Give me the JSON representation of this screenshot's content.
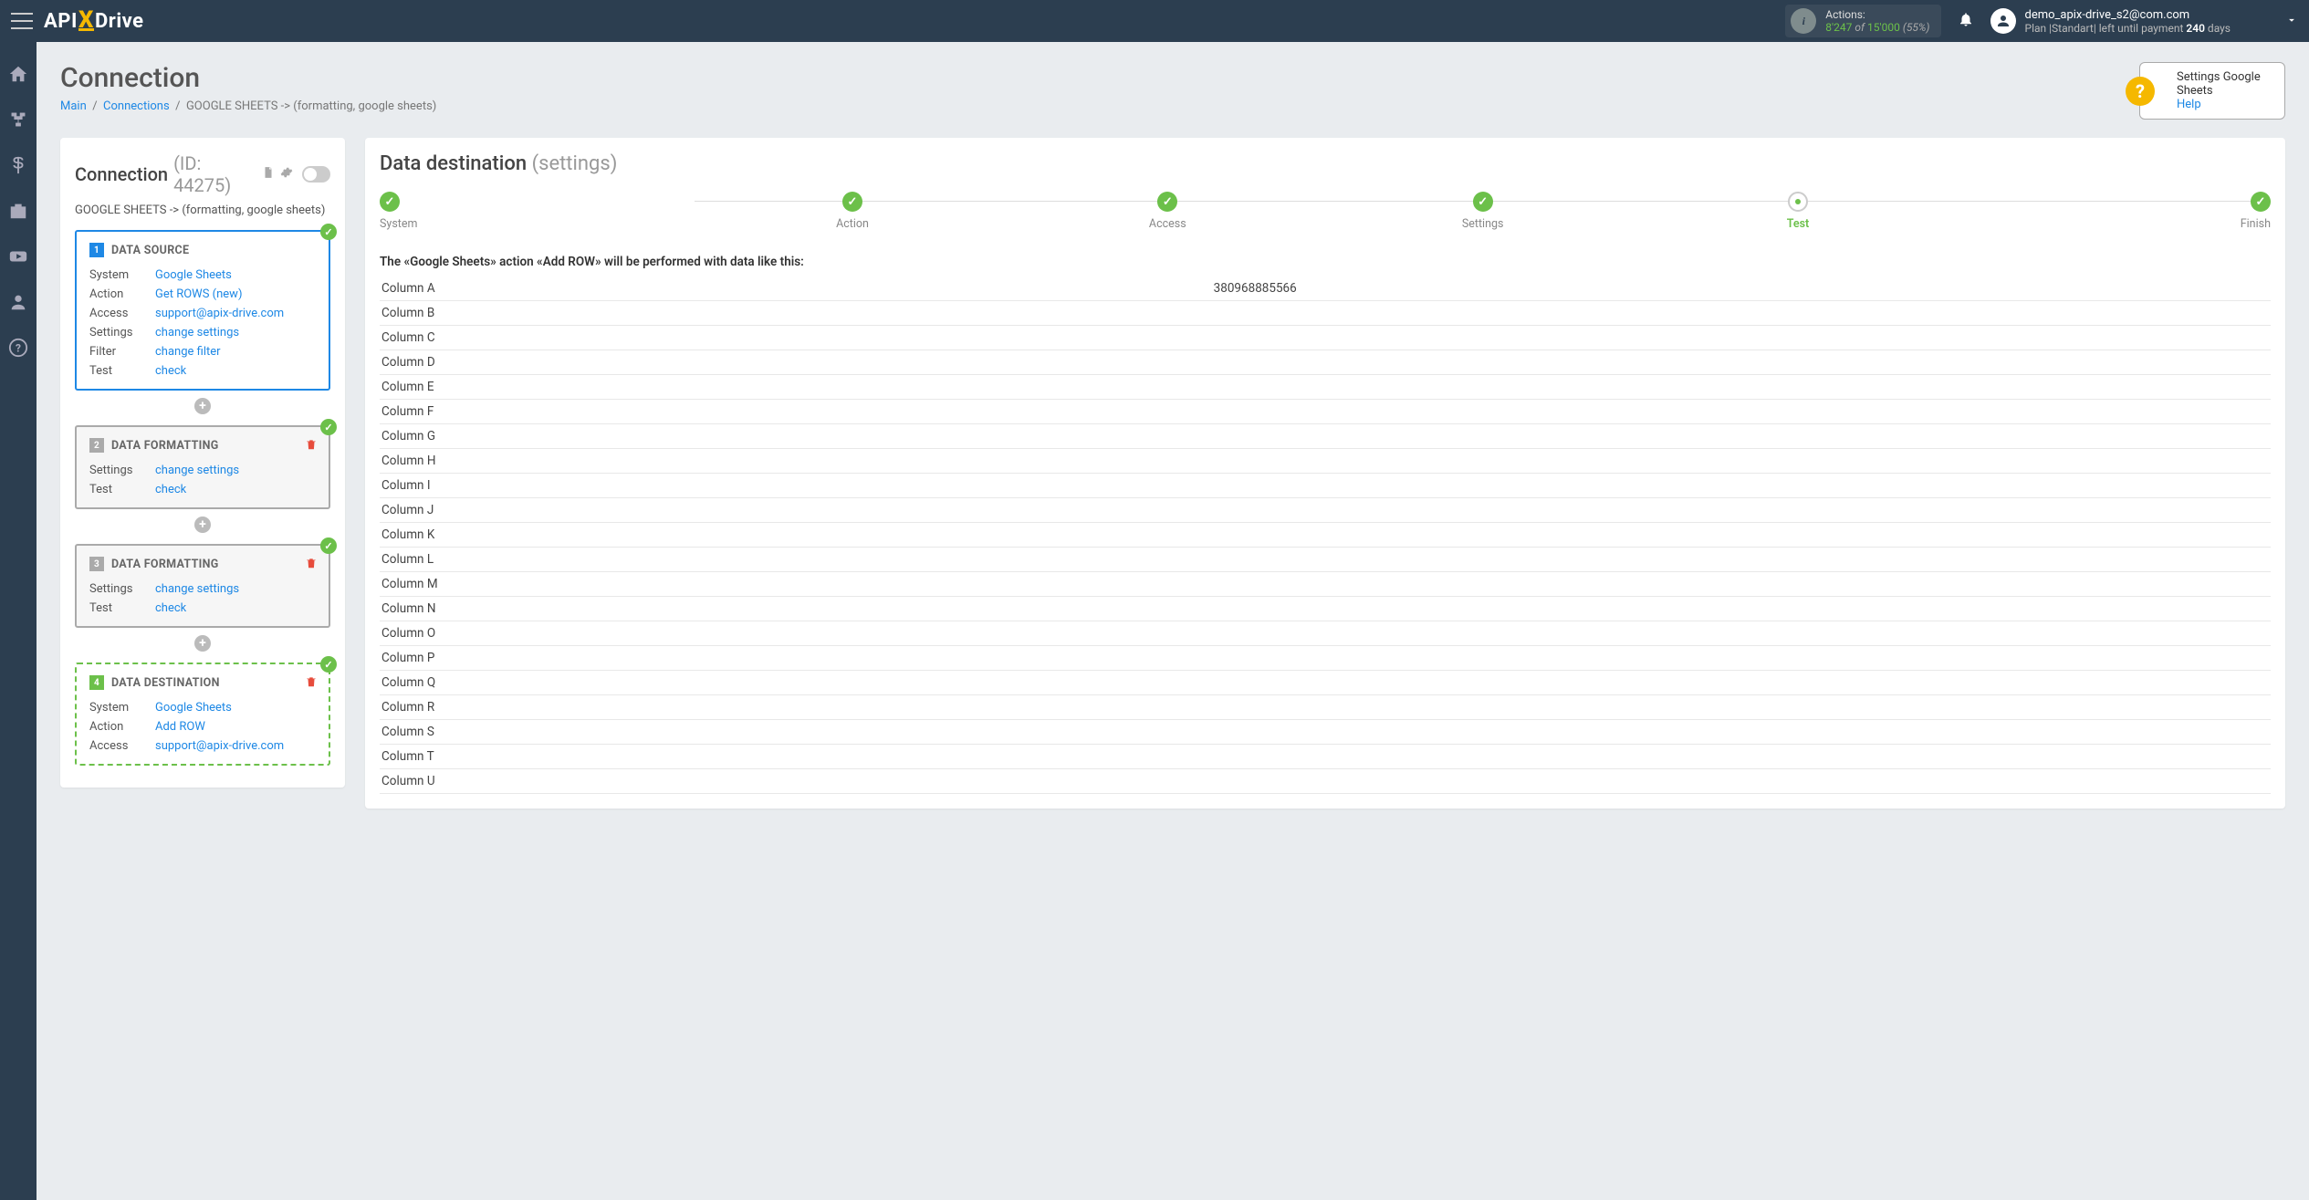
{
  "topbar": {
    "brand_api": "API",
    "brand_x": "X",
    "brand_drive": "Drive",
    "actions_label": "Actions:",
    "actions_used": "8'247",
    "actions_of": "of",
    "actions_total": "15'000",
    "actions_pct": "(55%)",
    "user_email": "demo_apix-drive_s2@com.com",
    "plan_prefix": "Plan |Standart| left until payment",
    "plan_days": "240",
    "plan_suffix": "days"
  },
  "page": {
    "title": "Connection",
    "breadcrumb": {
      "b1": "Main",
      "b2": "Connections",
      "b3": "GOOGLE SHEETS -> (formatting, google sheets)"
    }
  },
  "helpbox": {
    "t1": "Settings Google Sheets",
    "t2": "Help"
  },
  "panel": {
    "title": "Connection",
    "id_label": "(ID: 44275)",
    "subtitle": "GOOGLE SHEETS -> (formatting, google sheets)"
  },
  "cards": [
    {
      "index": "1",
      "title": "DATA SOURCE",
      "style": "active",
      "trash": false,
      "check": true,
      "rows": [
        {
          "k": "System",
          "v": "Google Sheets"
        },
        {
          "k": "Action",
          "v": "Get ROWS (new)"
        },
        {
          "k": "Access",
          "v": "support@apix-drive.com"
        },
        {
          "k": "Settings",
          "v": "change settings"
        },
        {
          "k": "Filter",
          "v": "change filter"
        },
        {
          "k": "Test",
          "v": "check"
        }
      ]
    },
    {
      "index": "2",
      "title": "DATA FORMATTING",
      "style": "gray",
      "trash": true,
      "check": true,
      "rows": [
        {
          "k": "Settings",
          "v": "change settings"
        },
        {
          "k": "Test",
          "v": "check"
        }
      ]
    },
    {
      "index": "3",
      "title": "DATA FORMATTING",
      "style": "gray",
      "trash": true,
      "check": true,
      "rows": [
        {
          "k": "Settings",
          "v": "change settings"
        },
        {
          "k": "Test",
          "v": "check"
        }
      ]
    },
    {
      "index": "4",
      "title": "DATA DESTINATION",
      "style": "green",
      "trash": true,
      "check": true,
      "rows": [
        {
          "k": "System",
          "v": "Google Sheets"
        },
        {
          "k": "Action",
          "v": "Add ROW"
        },
        {
          "k": "Access",
          "v": "support@apix-drive.com"
        }
      ]
    }
  ],
  "dest": {
    "title": "Data destination",
    "title_sub": "(settings)",
    "steps": [
      "System",
      "Action",
      "Access",
      "Settings",
      "Test",
      "Finish"
    ],
    "active_step": 4,
    "desc": "The «Google Sheets» action «Add ROW» will be performed with data like this:",
    "table": [
      {
        "col": "Column A",
        "val": "380968885566"
      },
      {
        "col": "Column B",
        "val": ""
      },
      {
        "col": "Column C",
        "val": ""
      },
      {
        "col": "Column D",
        "val": ""
      },
      {
        "col": "Column E",
        "val": ""
      },
      {
        "col": "Column F",
        "val": ""
      },
      {
        "col": "Column G",
        "val": ""
      },
      {
        "col": "Column H",
        "val": ""
      },
      {
        "col": "Column I",
        "val": ""
      },
      {
        "col": "Column J",
        "val": ""
      },
      {
        "col": "Column K",
        "val": ""
      },
      {
        "col": "Column L",
        "val": ""
      },
      {
        "col": "Column M",
        "val": ""
      },
      {
        "col": "Column N",
        "val": ""
      },
      {
        "col": "Column O",
        "val": ""
      },
      {
        "col": "Column P",
        "val": ""
      },
      {
        "col": "Column Q",
        "val": ""
      },
      {
        "col": "Column R",
        "val": ""
      },
      {
        "col": "Column S",
        "val": ""
      },
      {
        "col": "Column T",
        "val": ""
      },
      {
        "col": "Column U",
        "val": ""
      }
    ]
  }
}
